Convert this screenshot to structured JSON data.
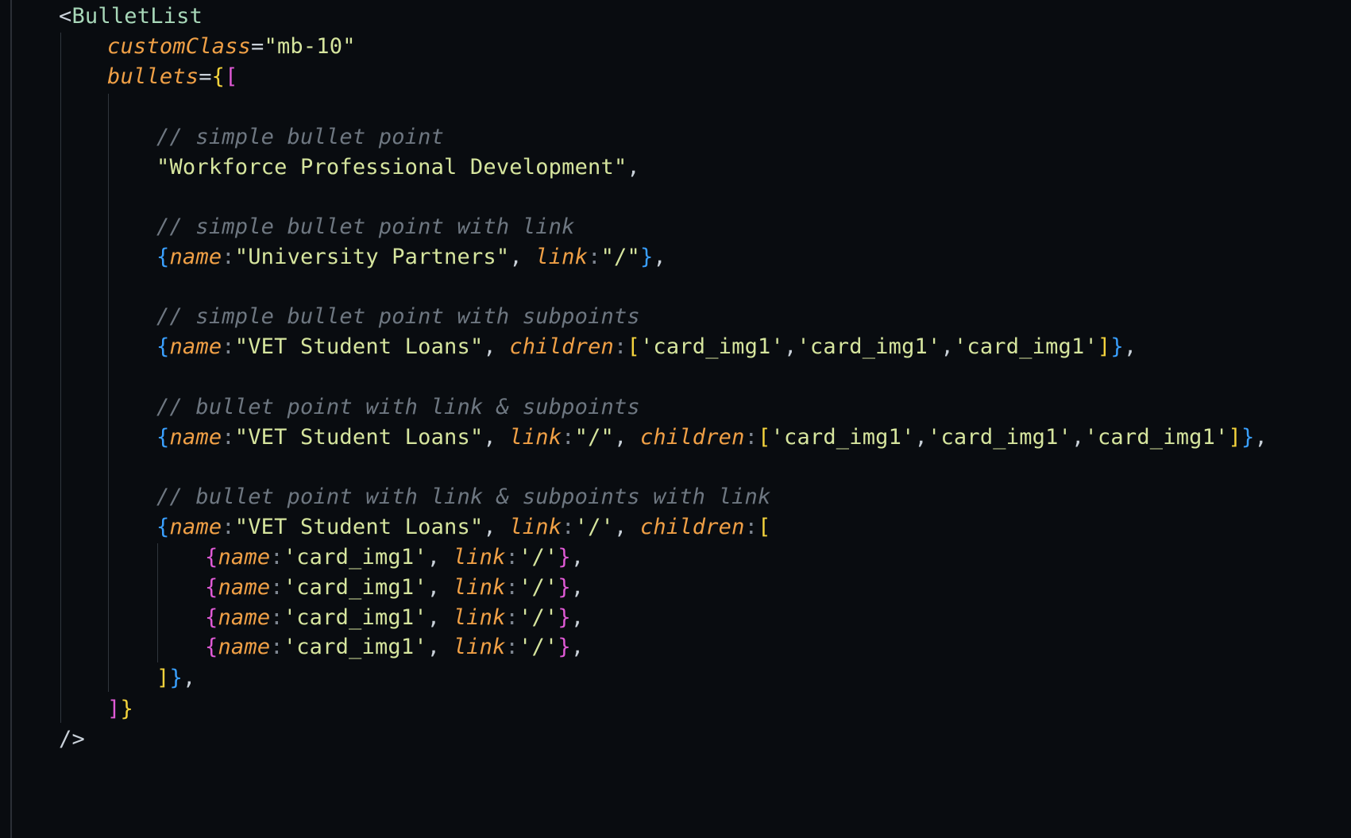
{
  "code": {
    "tag_open": "BulletList",
    "attr_customClass": "customClass",
    "attr_customClass_value": "\"mb-10\"",
    "attr_bullets": "bullets",
    "comment_1": "// simple bullet point",
    "string_1": "\"Workforce Professional Development\"",
    "comment_2": "// simple bullet point with link",
    "item2_name": "\"University Partners\"",
    "item2_link": "\"/\"",
    "comment_3": "// simple bullet point with subpoints",
    "item3_name": "\"VET Student Loans\"",
    "item3_children": [
      "'card_img1'",
      "'card_img1'",
      "'card_img1'"
    ],
    "comment_4": "// bullet point with link & subpoints",
    "item4_name": "\"VET Student Loans\"",
    "item4_link": "\"/\"",
    "item4_children": [
      "'card_img1'",
      "'card_img1'",
      "'card_img1'"
    ],
    "comment_5": "// bullet point with link & subpoints with link",
    "item5_name": "\"VET Student Loans\"",
    "item5_link": "'/'",
    "sub_items": [
      {
        "name": "'card_img1'",
        "link": "'/'"
      },
      {
        "name": "'card_img1'",
        "link": "'/'"
      },
      {
        "name": "'card_img1'",
        "link": "'/'"
      },
      {
        "name": "'card_img1'",
        "link": "'/'"
      }
    ],
    "key_name": "name",
    "key_link": "link",
    "key_children": "children",
    "tag_close": "/>"
  },
  "colors": {
    "background": "#090c10",
    "attribute": "#f0a046",
    "string": "#e6e08a",
    "comment": "#6e7781",
    "brace_yellow": "#f4d33c",
    "brace_purple": "#e05ad6",
    "brace_blue": "#3aa0ff"
  }
}
